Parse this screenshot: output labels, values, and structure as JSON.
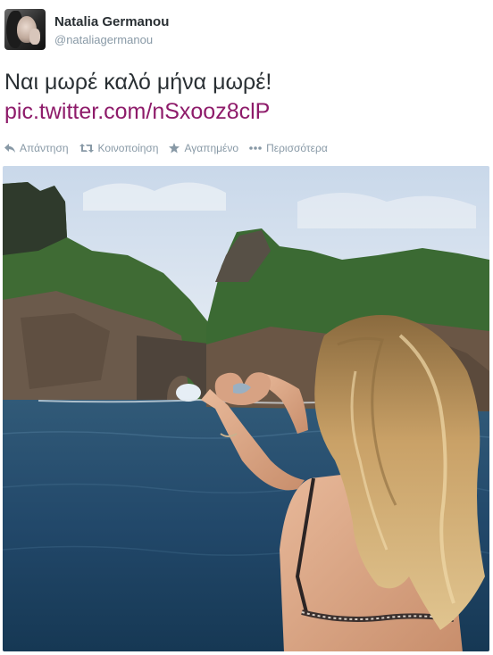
{
  "tweet": {
    "fullname": "Natalia Germanou",
    "username": "@nataliagermanou",
    "text": "Ναι μωρέ καλό μήνα μωρέ!",
    "link": "pic.twitter.com/nSxooz8clP",
    "actions": [
      {
        "label": "Απάντηση",
        "icon": "reply-icon"
      },
      {
        "label": "Κοινοποίηση",
        "icon": "retweet-icon"
      },
      {
        "label": "Αγαπημένο",
        "icon": "star-icon"
      },
      {
        "label": "Περισσότερα",
        "icon": "more-icon"
      }
    ],
    "photo": {
      "subject": "woman-making-heart-hands-facing-sea-arch"
    }
  },
  "colors": {
    "text": "#292f33",
    "muted": "#8899a6",
    "link": "#8e1b6a"
  }
}
